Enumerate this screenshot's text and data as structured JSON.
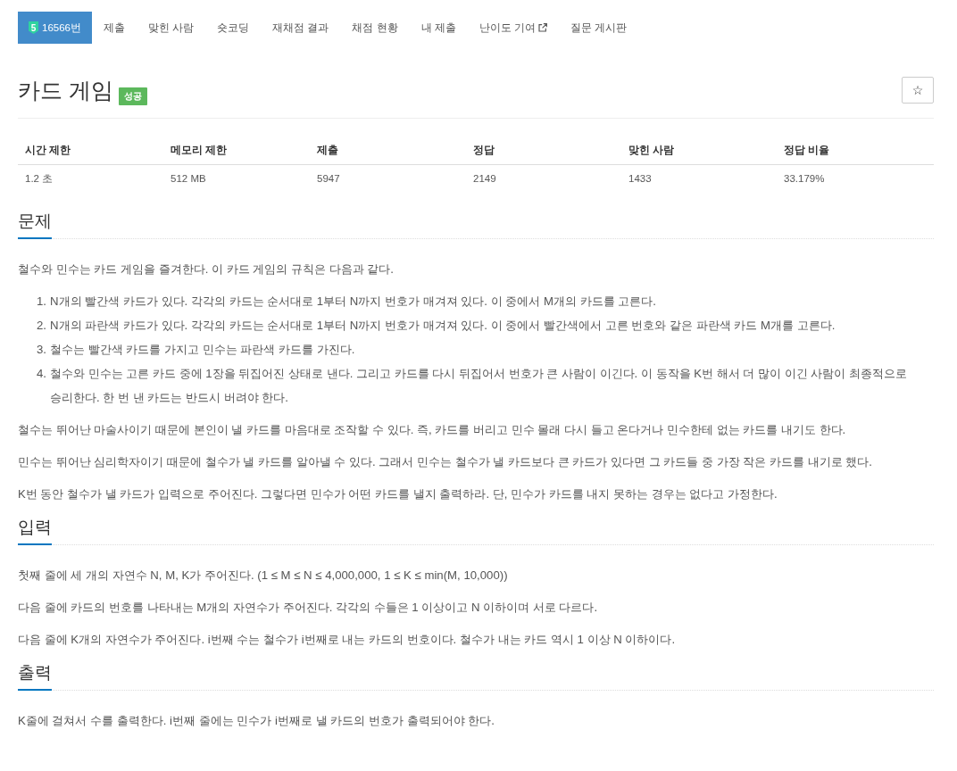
{
  "nav": {
    "items": [
      {
        "kind": "problem",
        "tier": "5",
        "label": "16566번",
        "selected": true
      },
      {
        "kind": "link",
        "label": "제출",
        "selected": false
      },
      {
        "kind": "link",
        "label": "맞힌 사람",
        "selected": false
      },
      {
        "kind": "link",
        "label": "숏코딩",
        "selected": false
      },
      {
        "kind": "link",
        "label": "재채점 결과",
        "selected": false
      },
      {
        "kind": "link",
        "label": "채점 현황",
        "selected": false
      },
      {
        "kind": "link",
        "label": "내 제출",
        "selected": false
      },
      {
        "kind": "external",
        "label": "난이도 기여",
        "selected": false
      },
      {
        "kind": "link",
        "label": "질문 게시판",
        "selected": false
      }
    ]
  },
  "problem": {
    "title": "카드 게임",
    "result_badge": "성공",
    "star_button": "☆"
  },
  "stats": {
    "columns": [
      "시간 제한",
      "메모리 제한",
      "제출",
      "정답",
      "맞힌 사람",
      "정답 비율"
    ],
    "rows": [
      [
        "1.2 초",
        "512 MB",
        "5947",
        "2149",
        "1433",
        "33.179%"
      ]
    ]
  },
  "sections": [
    {
      "heading": "문제",
      "blocks": [
        {
          "kind": "paragraph",
          "text": "철수와 민수는 카드 게임을 즐겨한다. 이 카드 게임의 규칙은 다음과 같다."
        },
        {
          "kind": "ordered_list",
          "items": [
            {
              "number": "1.",
              "text": "N개의 빨간색 카드가 있다. 각각의 카드는 순서대로 1부터 N까지 번호가 매겨져 있다. 이 중에서 M개의 카드를 고른다."
            },
            {
              "number": "2.",
              "text": "N개의 파란색 카드가 있다. 각각의 카드는 순서대로 1부터 N까지 번호가 매겨져 있다. 이 중에서 빨간색에서 고른 번호와 같은 파란색 카드 M개를 고른다."
            },
            {
              "number": "3.",
              "text": "철수는 빨간색 카드를 가지고 민수는 파란색 카드를 가진다."
            },
            {
              "number": "4.",
              "text": "철수와 민수는 고른 카드 중에 1장을 뒤집어진 상태로 낸다. 그리고 카드를 다시 뒤집어서 번호가 큰 사람이 이긴다. 이 동작을 K번 해서 더 많이 이긴 사람이 최종적으로 승리한다. 한 번 낸 카드는 반드시 버려야 한다."
            }
          ]
        },
        {
          "kind": "paragraph",
          "text": "철수는 뛰어난 마술사이기 때문에 본인이 낼 카드를 마음대로 조작할 수 있다. 즉, 카드를 버리고 민수 몰래 다시 들고 온다거나 민수한테 없는 카드를 내기도 한다."
        },
        {
          "kind": "paragraph",
          "text": "민수는 뛰어난 심리학자이기 때문에 철수가 낼 카드를 알아낼 수 있다. 그래서 민수는 철수가 낼 카드보다 큰 카드가 있다면 그 카드들 중 가장 작은 카드를 내기로 했다."
        },
        {
          "kind": "paragraph",
          "text": "K번 동안 철수가 낼 카드가 입력으로 주어진다. 그렇다면 민수가 어떤 카드를 낼지 출력하라. 단, 민수가 카드를 내지 못하는 경우는 없다고 가정한다."
        }
      ]
    },
    {
      "heading": "입력",
      "blocks": [
        {
          "kind": "paragraph",
          "text": "첫째 줄에 세 개의 자연수 N, M, K가 주어진다. (1 ≤ M ≤ N ≤ 4,000,000, 1 ≤ K ≤ min(M, 10,000))"
        },
        {
          "kind": "paragraph",
          "text": "다음 줄에 카드의 번호를 나타내는 M개의 자연수가 주어진다. 각각의 수들은 1 이상이고 N 이하이며 서로 다르다."
        },
        {
          "kind": "paragraph",
          "text": "다음 줄에 K개의 자연수가 주어진다. i번째 수는 철수가 i번째로 내는 카드의 번호이다. 철수가 내는 카드 역시 1 이상 N 이하이다."
        }
      ]
    },
    {
      "heading": "출력",
      "blocks": [
        {
          "kind": "paragraph",
          "text": "K줄에 걸쳐서 수를 출력한다. i번째 줄에는 민수가 i번째로 낼 카드의 번호가 출력되어야 한다."
        }
      ]
    }
  ]
}
